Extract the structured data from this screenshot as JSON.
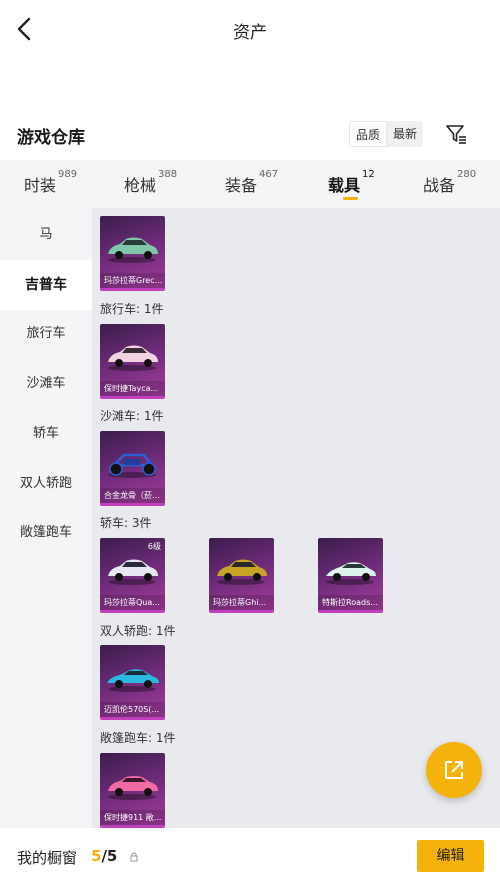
{
  "header": {
    "title": "资产"
  },
  "section": {
    "title": "游戏仓库",
    "sort_options": [
      "品质",
      "最新"
    ]
  },
  "tabs": [
    {
      "label": "时装",
      "count": "989"
    },
    {
      "label": "枪械",
      "count": "388"
    },
    {
      "label": "装备",
      "count": "467"
    },
    {
      "label": "载具",
      "count": "12",
      "active": true
    },
    {
      "label": "战备",
      "count": "280"
    }
  ],
  "sidebar": {
    "items": [
      {
        "label": "马"
      },
      {
        "label": "吉普车",
        "active": true
      },
      {
        "label": "旅行车"
      },
      {
        "label": "沙滩车"
      },
      {
        "label": "轿车"
      },
      {
        "label": "双人轿跑"
      },
      {
        "label": "敞篷跑车"
      }
    ]
  },
  "groups": [
    {
      "label": "",
      "cards": [
        {
          "name": "玛莎拉蒂Grec...",
          "color": "#7fc7a8"
        }
      ]
    },
    {
      "label": "旅行车: 1件",
      "cards": [
        {
          "name": "保时捷Tayca...",
          "color": "#f0d2e0"
        }
      ]
    },
    {
      "label": "沙滩车: 1件",
      "cards": [
        {
          "name": "合金龙骨（菸...",
          "color": "#2b5fd6"
        }
      ]
    },
    {
      "label": "轿车: 3件",
      "cards": [
        {
          "name": "玛莎拉蒂Qua...",
          "level": "6级",
          "color": "#e8e8f4"
        },
        {
          "name": "玛莎拉蒂Ghi...",
          "color": "#c9a22a"
        },
        {
          "name": "特斯拉Roads...",
          "color": "#dff3ee"
        }
      ]
    },
    {
      "label": "双人轿跑: 1件",
      "cards": [
        {
          "name": "迈凯伦570S(...",
          "color": "#2bb9e0"
        }
      ]
    },
    {
      "label": "敞篷跑车: 1件",
      "cards": [
        {
          "name": "保时捷911 敞...",
          "color": "#f06aa3"
        }
      ]
    }
  ],
  "bottom": {
    "label": "我的橱窗",
    "current": "5",
    "separator": "/",
    "max": "5",
    "edit_label": "编辑"
  },
  "colors": {
    "accent": "#f5b20a",
    "card_border": "#c13fbd"
  },
  "icons": {
    "back": "chevron-left-icon",
    "filter": "filter-icon",
    "share": "share-icon",
    "lock": "lock-icon"
  }
}
